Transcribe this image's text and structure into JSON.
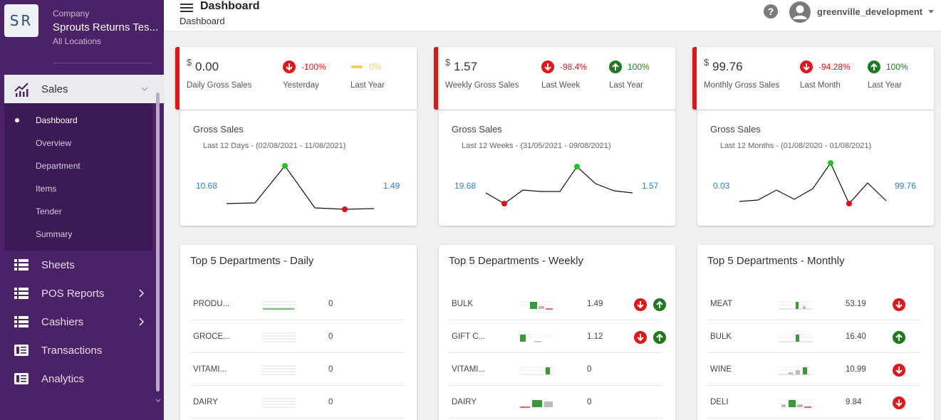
{
  "brand": {
    "logo_text": "SR",
    "company_label": "Company",
    "company_name": "Sprouts Returns Tes...",
    "location": "All Locations"
  },
  "sidebar": {
    "sales_label": "Sales",
    "sub_items": [
      "Dashboard",
      "Overview",
      "Department",
      "Items",
      "Tender",
      "Summary"
    ],
    "items": [
      {
        "label": "Sheets",
        "icon": "list-icon"
      },
      {
        "label": "POS Reports",
        "icon": "list-icon"
      },
      {
        "label": "Cashiers",
        "icon": "list-icon"
      },
      {
        "label": "Transactions",
        "icon": "receipt-icon"
      },
      {
        "label": "Analytics",
        "icon": "receipt-icon"
      }
    ]
  },
  "header": {
    "title": "Dashboard",
    "breadcrumb": "Dashboard",
    "user": "greenville_development",
    "help": "?"
  },
  "kpis": [
    {
      "currency": "$",
      "value": "0.00",
      "label": "Daily Gross Sales",
      "change1": {
        "text": "-100%",
        "label": "Yesterday",
        "icon": "down-arrow-icon",
        "color": "#e4141b"
      },
      "change2": {
        "text": "0%",
        "label": "Last Year",
        "icon": "dash-icon",
        "color": "#f4cf52"
      }
    },
    {
      "currency": "$",
      "value": "1.57",
      "label": "Weekly Gross Sales",
      "change1": {
        "text": "-98.4%",
        "label": "Last Week",
        "icon": "down-arrow-icon",
        "color": "#e4141b"
      },
      "change2": {
        "text": "100%",
        "label": "Last Year",
        "icon": "up-arrow-icon",
        "color": "#1f7a1f"
      }
    },
    {
      "currency": "$",
      "value": "99.76",
      "label": "Monthly Gross Sales",
      "change1": {
        "text": "-94.28%",
        "label": "Last Month",
        "icon": "down-arrow-icon",
        "color": "#e4141b"
      },
      "change2": {
        "text": "100%",
        "label": "Last Year",
        "icon": "up-arrow-icon",
        "color": "#1f7a1f"
      }
    }
  ],
  "sparks": [
    {
      "title": "Gross Sales",
      "sub": "Last 12 Days - (02/08/2021 - 11/08/2021)",
      "left": "10.68",
      "right": "1.49"
    },
    {
      "title": "Gross Sales",
      "sub": "Last 12 Weeks - (31/05/2021 - 09/08/2021)",
      "left": "19.68",
      "right": "1.57"
    },
    {
      "title": "Gross Sales",
      "sub": "Last 12 Months - (01/08/2020 - 01/08/2021)",
      "left": "0.03",
      "right": "99.76"
    }
  ],
  "depts": [
    {
      "title": "Top 5 Departments - Daily",
      "rows": [
        {
          "name": "PRODU...",
          "value": "0"
        },
        {
          "name": "GROCE...",
          "value": "0"
        },
        {
          "name": "VITAMI...",
          "value": "0"
        },
        {
          "name": "DAIRY",
          "value": "0"
        }
      ]
    },
    {
      "title": "Top 5 Departments - Weekly",
      "rows": [
        {
          "name": "BULK",
          "value": "1.49"
        },
        {
          "name": "GIFT C...",
          "value": "1.12"
        },
        {
          "name": "VITAMI...",
          "value": "0"
        },
        {
          "name": "DAIRY",
          "value": "0"
        }
      ]
    },
    {
      "title": "Top 5 Departments - Monthly",
      "rows": [
        {
          "name": "MEAT",
          "value": "53.19"
        },
        {
          "name": "BULK",
          "value": "16.40"
        },
        {
          "name": "WINE",
          "value": "10.99"
        },
        {
          "name": "DELI",
          "value": "9.84"
        }
      ]
    }
  ],
  "colors": {
    "sidebar": "#4b2268",
    "submenu": "#3b1a55",
    "accent_red": "#e4141b",
    "accent_green": "#1f7a1f",
    "link_blue": "#2d7fd1"
  }
}
